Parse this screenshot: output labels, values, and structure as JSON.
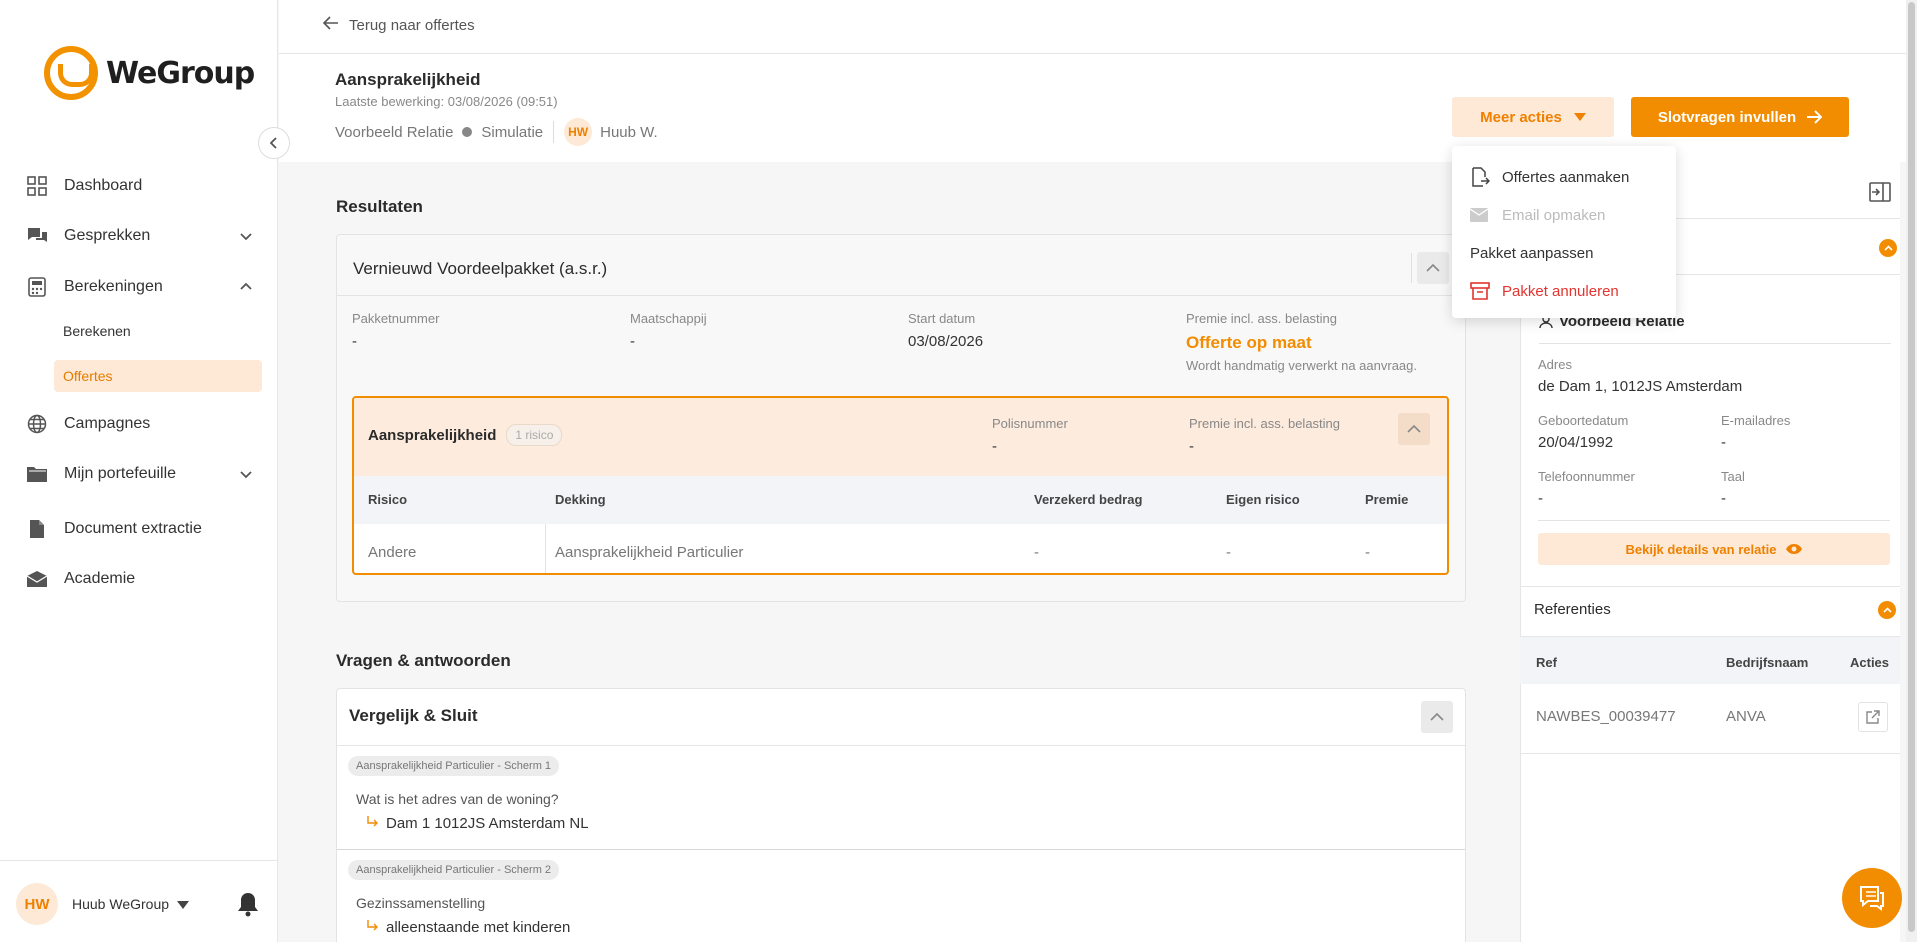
{
  "sidebar": {
    "logo_text": "WeGroup",
    "nav": {
      "dashboard": "Dashboard",
      "gesprekken": "Gesprekken",
      "berekeningen": "Berekeningen",
      "berekenen": "Berekenen",
      "offertes": "Offertes",
      "campagnes": "Campagnes",
      "portefeuille": "Mijn portefeuille",
      "document_extractie": "Document extractie",
      "academie": "Academie"
    },
    "user": {
      "initials": "HW",
      "name": "Huub WeGroup"
    }
  },
  "topbar": {
    "back_label": "Terug naar offertes"
  },
  "header": {
    "title": "Aansprakelijkheid",
    "last_edit": "Laatste bewerking: 03/08/2026 (09:51)",
    "relation": "Voorbeeld Relatie",
    "status": "Simulatie",
    "owner_initials": "HW",
    "owner_name": "Huub W.",
    "more_actions_label": "Meer acties",
    "primary_label": "Slotvragen invullen"
  },
  "dropdown": {
    "items": [
      {
        "label": "Offertes aanmaken"
      },
      {
        "label": "Email opmaken"
      },
      {
        "label": "Pakket aanpassen"
      },
      {
        "label": "Pakket annuleren"
      }
    ]
  },
  "results": {
    "section_title": "Resultaten",
    "package_title": "Vernieuwd Voordeelpakket (a.s.r.)",
    "fields": {
      "pakketnummer_label": "Pakketnummer",
      "pakketnummer_value": "-",
      "maatschappij_label": "Maatschappij",
      "maatschappij_value": "-",
      "start_label": "Start datum",
      "start_value": "03/08/2026",
      "premie_label": "Premie incl. ass. belasting",
      "premie_value": "Offerte op maat",
      "premie_note": "Wordt handmatig verwerkt na aanvraag."
    },
    "sub": {
      "title": "Aansprakelijkheid",
      "badge": "1 risico",
      "polis_label": "Polisnummer",
      "polis_value": "-",
      "premie_label": "Premie incl. ass. belasting",
      "premie_value": "-",
      "columns": [
        "Risico",
        "Dekking",
        "Verzekerd bedrag",
        "Eigen risico",
        "Premie"
      ],
      "row": [
        "Andere",
        "Aansprakelijkheid Particulier",
        "-",
        "-",
        "-"
      ]
    }
  },
  "qa": {
    "section_title": "Vragen & antwoorden",
    "card_title": "Vergelijk & Sluit",
    "items": [
      {
        "tag": "Aansprakelijkheid Particulier - Scherm 1",
        "question": "Wat is het adres van de woning?",
        "answer": "Dam 1 1012JS Amsterdam NL"
      },
      {
        "tag": "Aansprakelijkheid Particulier - Scherm 2",
        "question": "Gezinssamenstelling",
        "answer": "alleenstaande met kinderen"
      }
    ]
  },
  "relation_panel": {
    "name": "Voorbeeld Relatie",
    "adres_label": "Adres",
    "adres_value": "de Dam 1, 1012JS Amsterdam",
    "geboorte_label": "Geboortedatum",
    "geboorte_value": "20/04/1992",
    "email_label": "E-mailadres",
    "email_value": "-",
    "telefoon_label": "Telefoonnummer",
    "telefoon_value": "-",
    "taal_label": "Taal",
    "taal_value": "-",
    "details_button": "Bekijk details van relatie"
  },
  "references": {
    "title": "Referenties",
    "columns": [
      "Ref",
      "Bedrijfsnaam",
      "Acties"
    ],
    "row": [
      "NAWBES_00039477",
      "ANVA"
    ]
  },
  "colors": {
    "accent": "#f28c00",
    "accent_light": "#fde9d5",
    "danger": "#e3342f"
  }
}
